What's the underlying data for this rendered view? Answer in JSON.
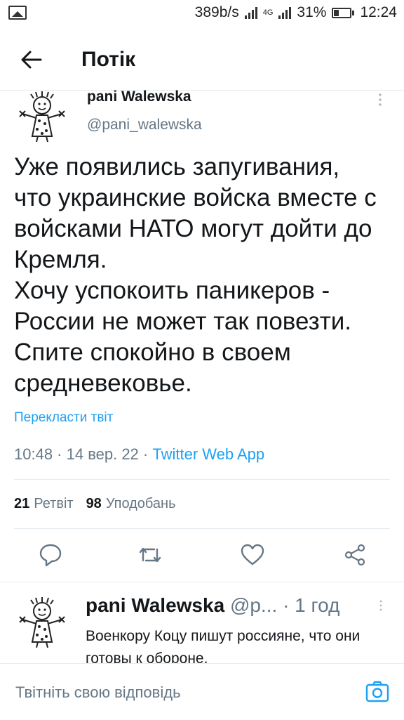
{
  "status_bar": {
    "speed": "389b/s",
    "network": "4G",
    "battery": "31%",
    "time": "12:24"
  },
  "header": {
    "title": "Потік"
  },
  "tweet": {
    "author_name": "pani Walewska",
    "author_handle": "@pani_walewska",
    "text": "Уже появились запугивания,\nчто украинские войска вместе с\nвойсками НАТО могут дойти до\nКремля.\nХочу успокоить паникеров -\nРоссии не может так повезти.\nСпите спокойно в своем\nсредневековье.",
    "translate_label": "Перекласти твіт",
    "timestamp": "10:48 · 14 вер. 22 · ",
    "source": "Twitter Web App",
    "retweets_count": "21",
    "retweets_label": "Ретвіт",
    "likes_count": "98",
    "likes_label": "Уподобань"
  },
  "reply": {
    "author_name": "pani Walewska",
    "author_handle": "@p...",
    "time": "· 1 год",
    "text": "Военкору Коцу пишут россияне, что они готовы к обороне."
  },
  "composer": {
    "placeholder": "Твітніть свою відповідь"
  },
  "colors": {
    "accent": "#1da1f2",
    "secondary_text": "#657786"
  },
  "icons": [
    "image-icon",
    "signal-icon",
    "back-arrow-icon",
    "more-icon",
    "reply-icon",
    "retweet-icon",
    "like-icon",
    "share-icon",
    "camera-icon"
  ]
}
